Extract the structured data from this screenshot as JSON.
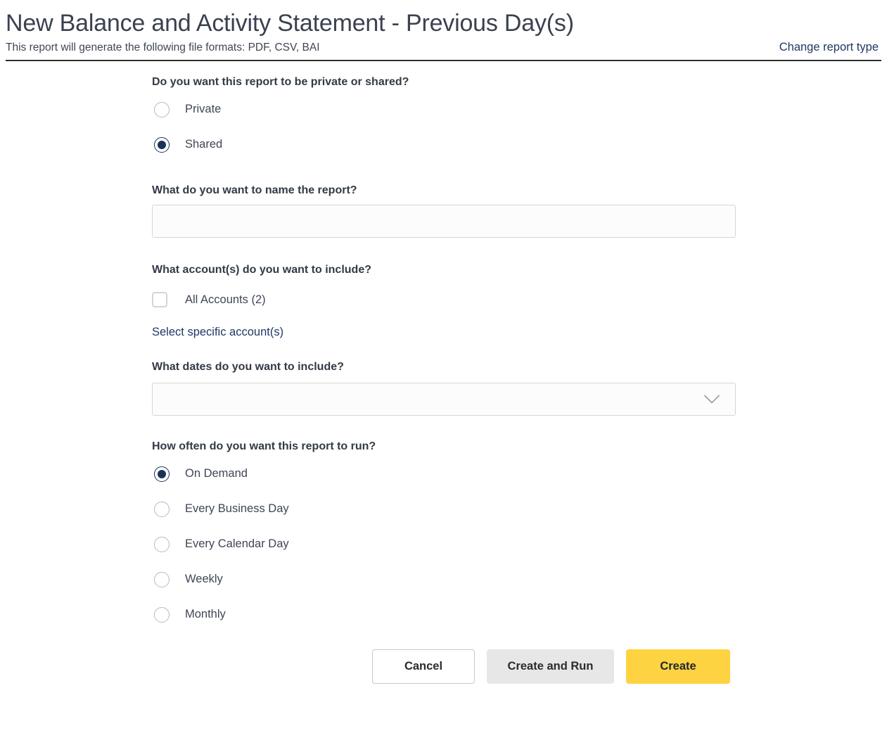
{
  "header": {
    "title": "New Balance and Activity Statement - Previous Day(s)",
    "subtitle": "This report will generate the following file formats: PDF, CSV, BAI",
    "change_report_link": "Change report type"
  },
  "form": {
    "visibility": {
      "question": "Do you want this report to be private or shared?",
      "options": [
        {
          "label": "Private",
          "selected": false
        },
        {
          "label": "Shared",
          "selected": true
        }
      ]
    },
    "report_name": {
      "question": "What do you want to name the report?",
      "value": "",
      "placeholder": ""
    },
    "accounts": {
      "question": "What account(s) do you want to include?",
      "all_accounts_label": "All Accounts (2)",
      "all_accounts_checked": false,
      "select_specific_link": "Select specific account(s)"
    },
    "dates": {
      "question": "What dates do you want to include?",
      "value": "",
      "chevron_icon": "chevron-down-icon"
    },
    "frequency": {
      "question": "How often do you want this report to run?",
      "options": [
        {
          "label": "On Demand",
          "selected": true
        },
        {
          "label": "Every Business Day",
          "selected": false
        },
        {
          "label": "Every Calendar Day",
          "selected": false
        },
        {
          "label": "Weekly",
          "selected": false
        },
        {
          "label": "Monthly",
          "selected": false
        }
      ]
    }
  },
  "actions": {
    "cancel": "Cancel",
    "create_and_run": "Create and Run",
    "create": "Create"
  },
  "colors": {
    "primary_yellow": "#fdd341",
    "navy": "#1b3258",
    "link": "#1f3864",
    "secondary_gray": "#e7e7e7"
  }
}
